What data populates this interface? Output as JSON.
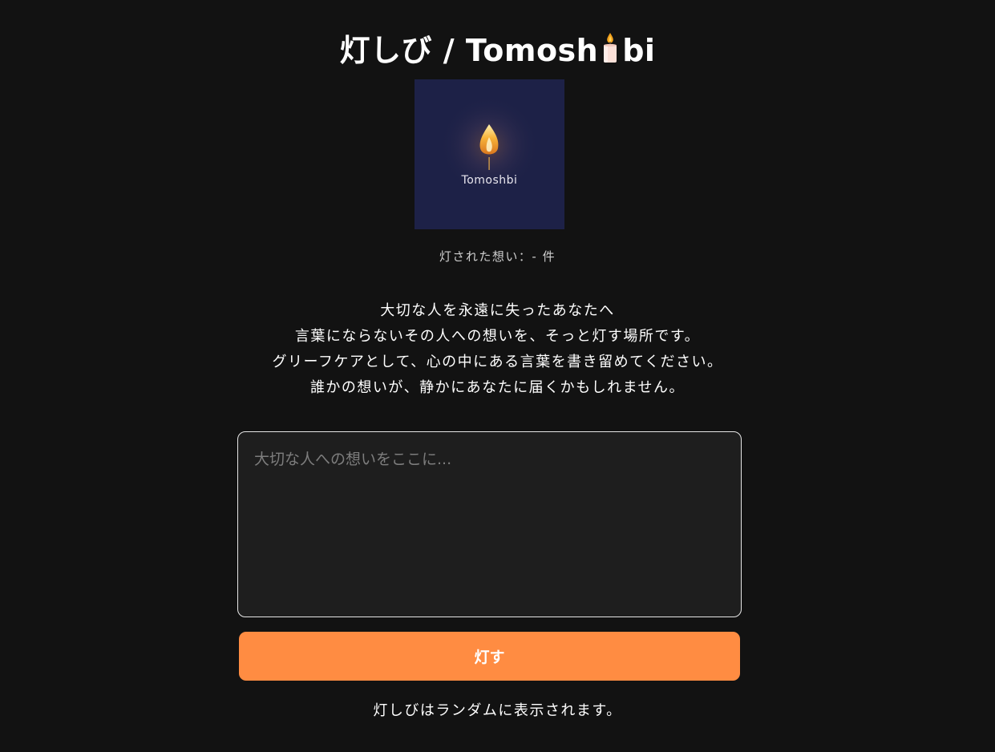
{
  "header": {
    "title_before": "灯しび / Tomosh",
    "title_icon": "candle-icon",
    "title_after": "bi"
  },
  "logo": {
    "text": "Tomoshbi",
    "icon": "flame-icon"
  },
  "stats": {
    "count_text": "灯された想い：- 件"
  },
  "intro": {
    "lines": [
      "大切な人を永遠に失ったあなたへ",
      "言葉にならないその人への想いを、そっと灯す場所です。",
      "グリーフケアとして、心の中にある言葉を書き留めてください。",
      "誰かの想いが、静かにあなたに届くかもしれません。"
    ]
  },
  "form": {
    "placeholder": "大切な人への想いをここに...",
    "value": "",
    "submit_label": "灯す"
  },
  "footer": {
    "note": "灯しびはランダムに表示されます。"
  },
  "colors": {
    "background": "#121212",
    "accent": "#ff8c42",
    "logo_background": "#1d2147"
  }
}
